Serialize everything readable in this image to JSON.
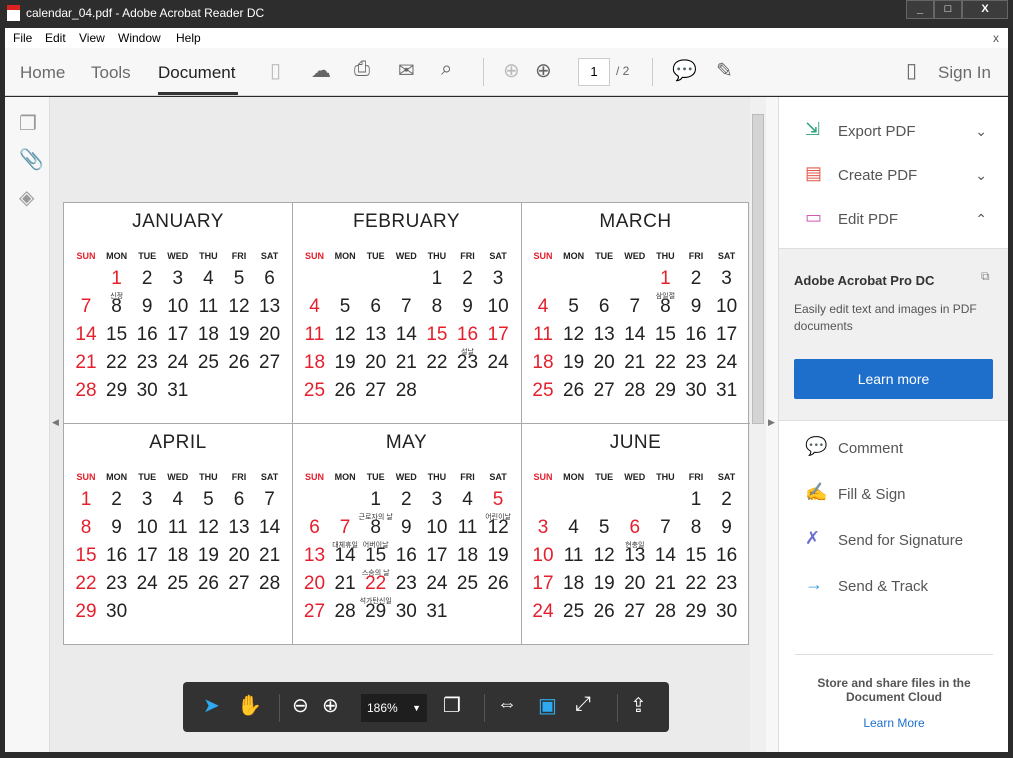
{
  "window": {
    "title": "calendar_04.pdf - Adobe Acrobat Reader DC",
    "minimize": "_",
    "maximize": "□",
    "close": "X"
  },
  "menu": [
    "File",
    "Edit",
    "View",
    "Window",
    "Help"
  ],
  "menu_close": "x",
  "toolbar": {
    "tabs": [
      "Home",
      "Tools",
      "Document"
    ],
    "active_tab": "Document",
    "page_current": "1",
    "page_total": "/ 2",
    "sign_in": "Sign In"
  },
  "calendar": {
    "weekdays": [
      "SUN",
      "MON",
      "TUE",
      "WED",
      "THU",
      "FRI",
      "SAT"
    ],
    "colors": {
      "holiday": "#e4202d",
      "text": "#222222"
    },
    "months": [
      {
        "name": "JANUARY",
        "first_weekday": 1,
        "days": 31,
        "red_days": [
          1
        ],
        "labels": {
          "1": "신정"
        }
      },
      {
        "name": "FEBRUARY",
        "first_weekday": 4,
        "days": 28,
        "red_days": [
          15,
          16,
          17
        ],
        "labels": {
          "16": "설날"
        }
      },
      {
        "name": "MARCH",
        "first_weekday": 4,
        "days": 31,
        "red_days": [
          1
        ],
        "labels": {
          "1": "삼일절"
        }
      },
      {
        "name": "APRIL",
        "first_weekday": 0,
        "days": 30,
        "red_days": [],
        "labels": {}
      },
      {
        "name": "MAY",
        "first_weekday": 2,
        "days": 31,
        "red_days": [
          5,
          7,
          22
        ],
        "labels": {
          "1": "근로자의 날",
          "5": "어린이날",
          "7": "대체휴일",
          "8": "어버이날",
          "15": "스승의 날",
          "22": "석가탄신일"
        }
      },
      {
        "name": "JUNE",
        "first_weekday": 5,
        "days": 30,
        "red_days": [
          6
        ],
        "labels": {
          "6": "현충일"
        }
      }
    ]
  },
  "right_pane": {
    "tools": [
      {
        "label": "Export PDF",
        "icon": "export-pdf-icon"
      },
      {
        "label": "Create PDF",
        "icon": "create-pdf-icon"
      },
      {
        "label": "Edit PDF",
        "icon": "edit-pdf-icon"
      }
    ],
    "promo": {
      "title": "Adobe Acrobat Pro DC",
      "text": "Easily edit text and images in PDF documents",
      "button": "Learn more",
      "accent": "#1e6fcc"
    },
    "more_tools": [
      {
        "label": "Comment",
        "icon": "comment-icon"
      },
      {
        "label": "Fill & Sign",
        "icon": "fill-sign-icon"
      },
      {
        "label": "Send for Signature",
        "icon": "send-signature-icon"
      },
      {
        "label": "Send & Track",
        "icon": "send-track-icon"
      }
    ],
    "cloud": {
      "text": "Store and share files in the Document Cloud",
      "link": "Learn More"
    }
  },
  "bottom_toolbar": {
    "zoom": "186%"
  }
}
